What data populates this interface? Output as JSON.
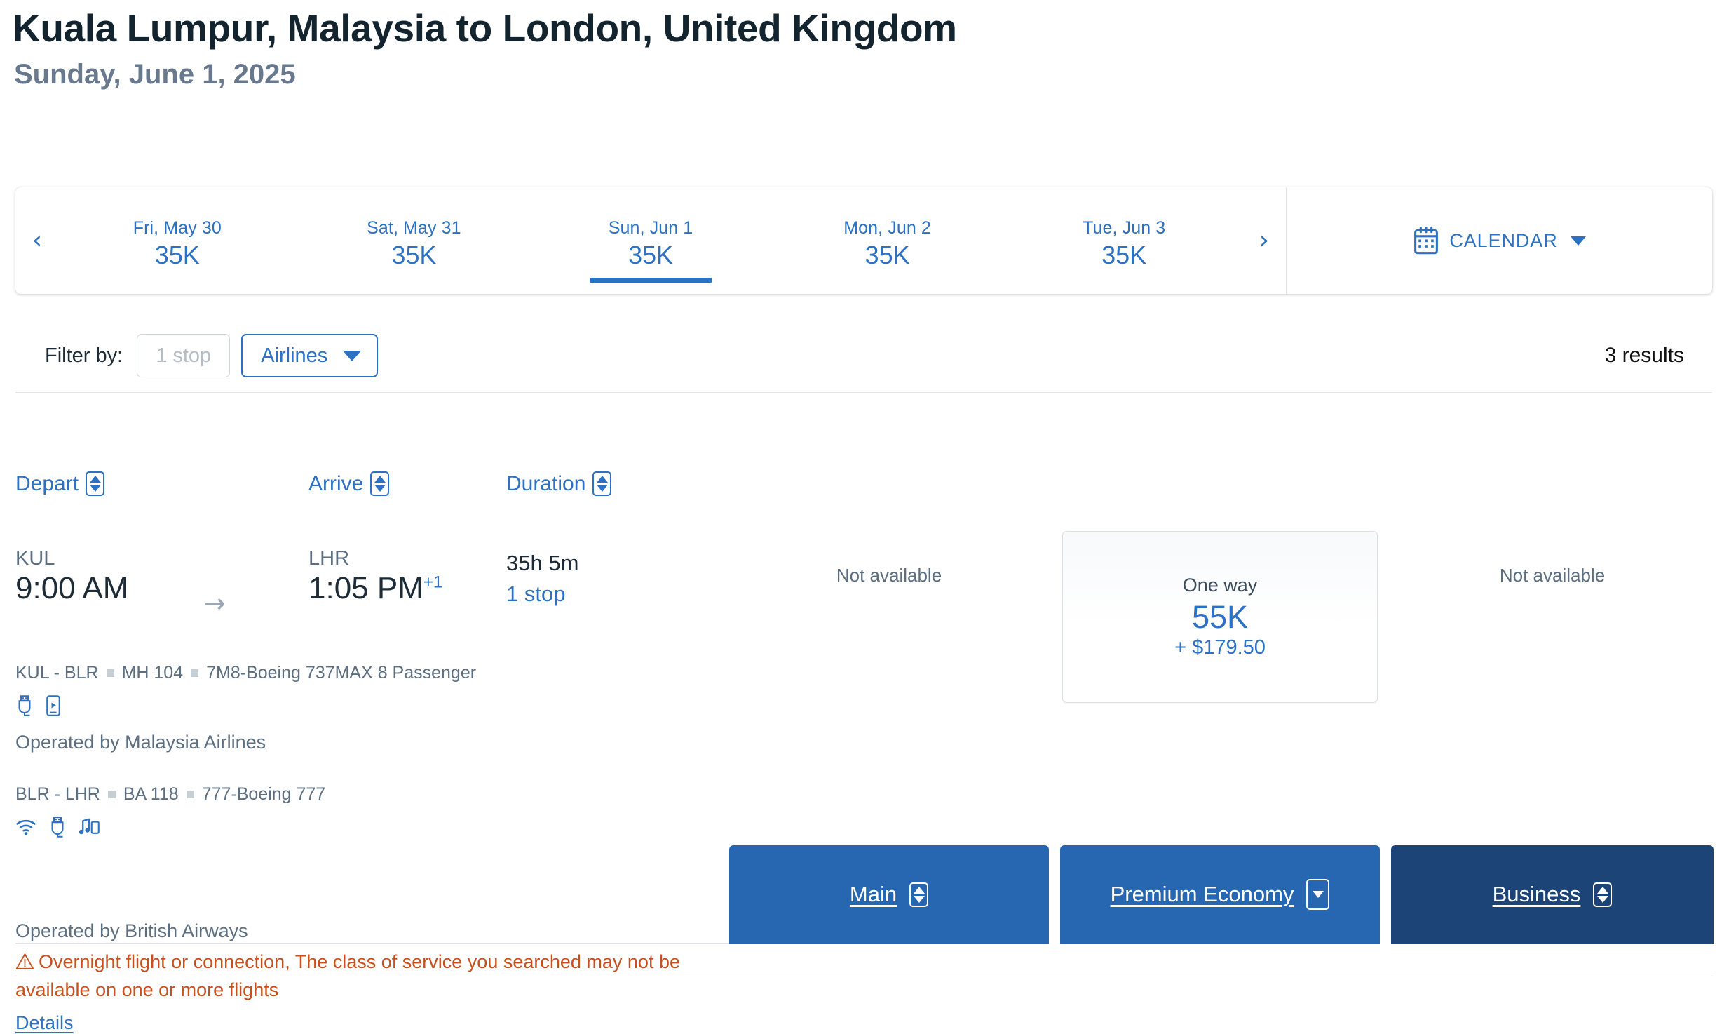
{
  "header": {
    "title": "Kuala Lumpur, Malaysia to London, United Kingdom",
    "subtitle": "Sunday, June 1, 2025"
  },
  "date_strip": {
    "prev_arrow": "‹",
    "next_arrow": "›",
    "dates": [
      {
        "label": "Fri, May 30",
        "price": "35K",
        "selected": false
      },
      {
        "label": "Sat, May 31",
        "price": "35K",
        "selected": false
      },
      {
        "label": "Sun, Jun 1",
        "price": "35K",
        "selected": true
      },
      {
        "label": "Mon, Jun 2",
        "price": "35K",
        "selected": false
      },
      {
        "label": "Tue, Jun 3",
        "price": "35K",
        "selected": false
      }
    ],
    "calendar_button": {
      "label": "CALENDAR",
      "icon": "calendar-icon",
      "caret": "chevron-down-icon"
    }
  },
  "filters": {
    "label": "Filter by:",
    "stops_chip": "1 stop",
    "airlines_chip": "Airlines",
    "results_count": "3 results"
  },
  "columns": {
    "depart": "Depart",
    "arrive": "Arrive",
    "duration": "Duration"
  },
  "cabins": [
    {
      "id": "main",
      "label": "Main",
      "sort": "both",
      "color": "#2766b0"
    },
    {
      "id": "premium_economy",
      "label": "Premium Economy",
      "sort": "down",
      "color": "#2766b0"
    },
    {
      "id": "business",
      "label": "Business",
      "sort": "both",
      "color": "#1d4477"
    }
  ],
  "flight": {
    "depart": {
      "airport": "KUL",
      "time": "9:00 AM",
      "day_offset": ""
    },
    "arrive": {
      "airport": "LHR",
      "time": "1:05 PM",
      "day_offset": "+1"
    },
    "duration": "35h 5m",
    "stops": "1 stop",
    "segments": [
      {
        "route": "KUL - BLR",
        "flight_number": "MH 104",
        "equipment": "7M8-Boeing 737MAX 8 Passenger",
        "amenities": [
          "usb-power-icon",
          "streaming-device-icon"
        ],
        "operated_by": "Operated by Malaysia Airlines"
      },
      {
        "route": "BLR - LHR",
        "flight_number": "BA 118",
        "equipment": "777-Boeing 777",
        "amenities": [
          "wifi-icon",
          "usb-power-icon",
          "entertainment-icon"
        ],
        "operated_by": "Operated by British Airways"
      }
    ],
    "warning": "Overnight flight or connection, The class of service you searched may not be available on one or more flights",
    "details_link": "Details",
    "fares": {
      "main": {
        "available": false,
        "not_available_text": "Not available"
      },
      "premium_economy": {
        "available": true,
        "trip_type": "One way",
        "miles": "55K",
        "cash": "+ $179.50"
      },
      "business": {
        "available": false,
        "not_available_text": "Not available"
      }
    }
  },
  "colors": {
    "link_blue": "#2c71c4",
    "cabin_blue": "#2766b0",
    "business_navy": "#1d4477",
    "warning_orange": "#c7501c",
    "text_dark": "#1c2b36",
    "text_muted": "#5c6f80"
  }
}
